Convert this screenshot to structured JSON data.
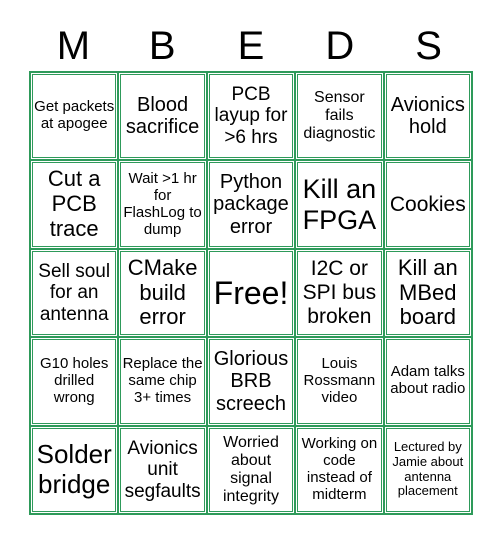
{
  "header": [
    "M",
    "B",
    "E",
    "D",
    "S"
  ],
  "grid_color": "#2e9a5a",
  "cells": [
    [
      "Get packets at apogee",
      "Blood sacrifice",
      "PCB layup for >6 hrs",
      "Sensor fails diagnostic",
      "Avionics hold"
    ],
    [
      "Cut a PCB trace",
      "Wait >1 hr for FlashLog to dump",
      "Python package error",
      "Kill an FPGA",
      "Cookies"
    ],
    [
      "Sell soul for an antenna",
      "CMake build error",
      "Free!",
      "I2C or SPI bus broken",
      "Kill an MBed board"
    ],
    [
      "G10 holes drilled wrong",
      "Replace the same chip 3+ times",
      "Glorious BRB screech",
      "Louis Rossmann video",
      "Adam talks about radio"
    ],
    [
      "Solder bridge",
      "Avionics unit segfaults",
      "Worried about signal integrity",
      "Working on code instead of midterm",
      "Lectured by Jamie about antenna placement"
    ]
  ]
}
